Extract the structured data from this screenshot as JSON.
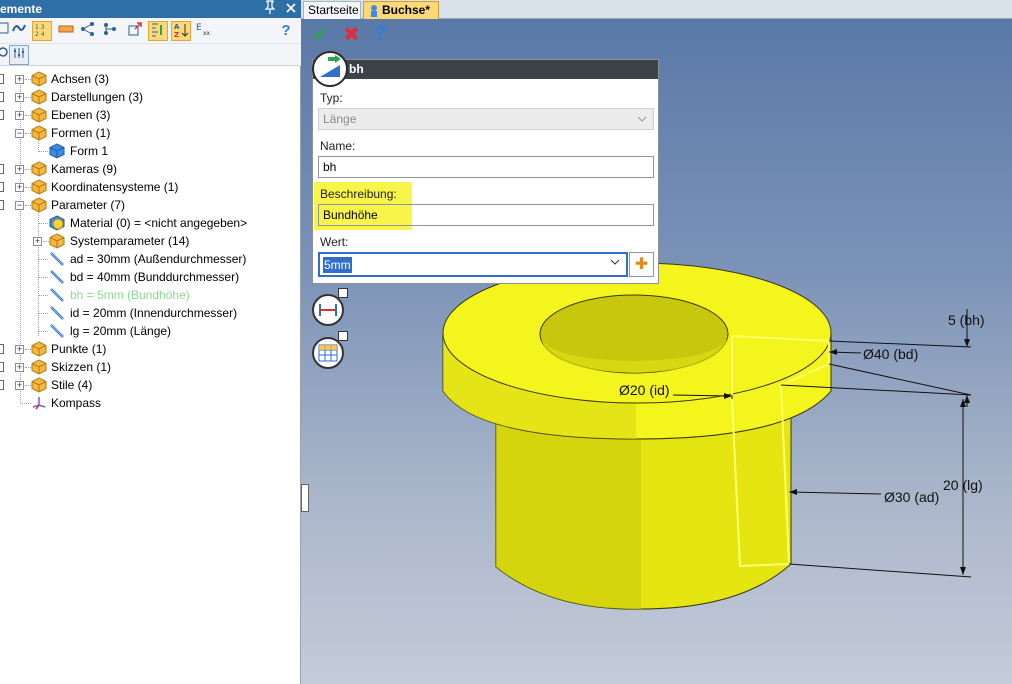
{
  "panel": {
    "title": "emente",
    "pin_glyph": "1",
    "close_glyph": "×"
  },
  "tree": {
    "items": [
      {
        "label": "Achsen (3)"
      },
      {
        "label": "Darstellungen (3)"
      },
      {
        "label": "Ebenen (3)"
      },
      {
        "label": "Formen (1)"
      },
      {
        "label": "Form 1"
      },
      {
        "label": "Kameras (9)"
      },
      {
        "label": "Koordinatensysteme (1)"
      },
      {
        "label": "Parameter (7)"
      },
      {
        "label": "Material (0) = <nicht angegeben>"
      },
      {
        "label": "Systemparameter (14)"
      },
      {
        "label": "ad = 30mm (Außendurchmesser)"
      },
      {
        "label": "bd = 40mm (Bunddurchmesser)"
      },
      {
        "label": "bh = 5mm (Bundhöhe)"
      },
      {
        "label": "id = 20mm (Innendurchmesser)"
      },
      {
        "label": "lg = 20mm (Länge)"
      },
      {
        "label": "Punkte (1)"
      },
      {
        "label": "Skizzen (1)"
      },
      {
        "label": "Stile (4)"
      },
      {
        "label": "Kompass"
      }
    ]
  },
  "tabs": {
    "start": "Startseite",
    "active": "Buchse*"
  },
  "dialog": {
    "title": "bh",
    "type_label": "Typ:",
    "type_value": "Länge",
    "name_label": "Name:",
    "name_value": "bh",
    "desc_label": "Beschreibung:",
    "desc_value": "Bundhöhe",
    "value_label": "Wert:",
    "value_value": "5mm"
  },
  "dimensions": {
    "bh": "5 (bh)",
    "bd": "Ø40 (bd)",
    "id": "Ø20 (id)",
    "lg": "20 (lg)",
    "ad": "Ø30 (ad)"
  },
  "colors": {
    "accent_tab": "#fbd977",
    "panel_header": "#2e6fa8",
    "part_yellow": "#f5f51e",
    "highlight": "#f8f44a",
    "dim_item": "#8fd88f"
  },
  "icons": {
    "ok": "✔",
    "cancel": "✖",
    "help": "?",
    "plus": "✚",
    "chevron": "⌄"
  }
}
